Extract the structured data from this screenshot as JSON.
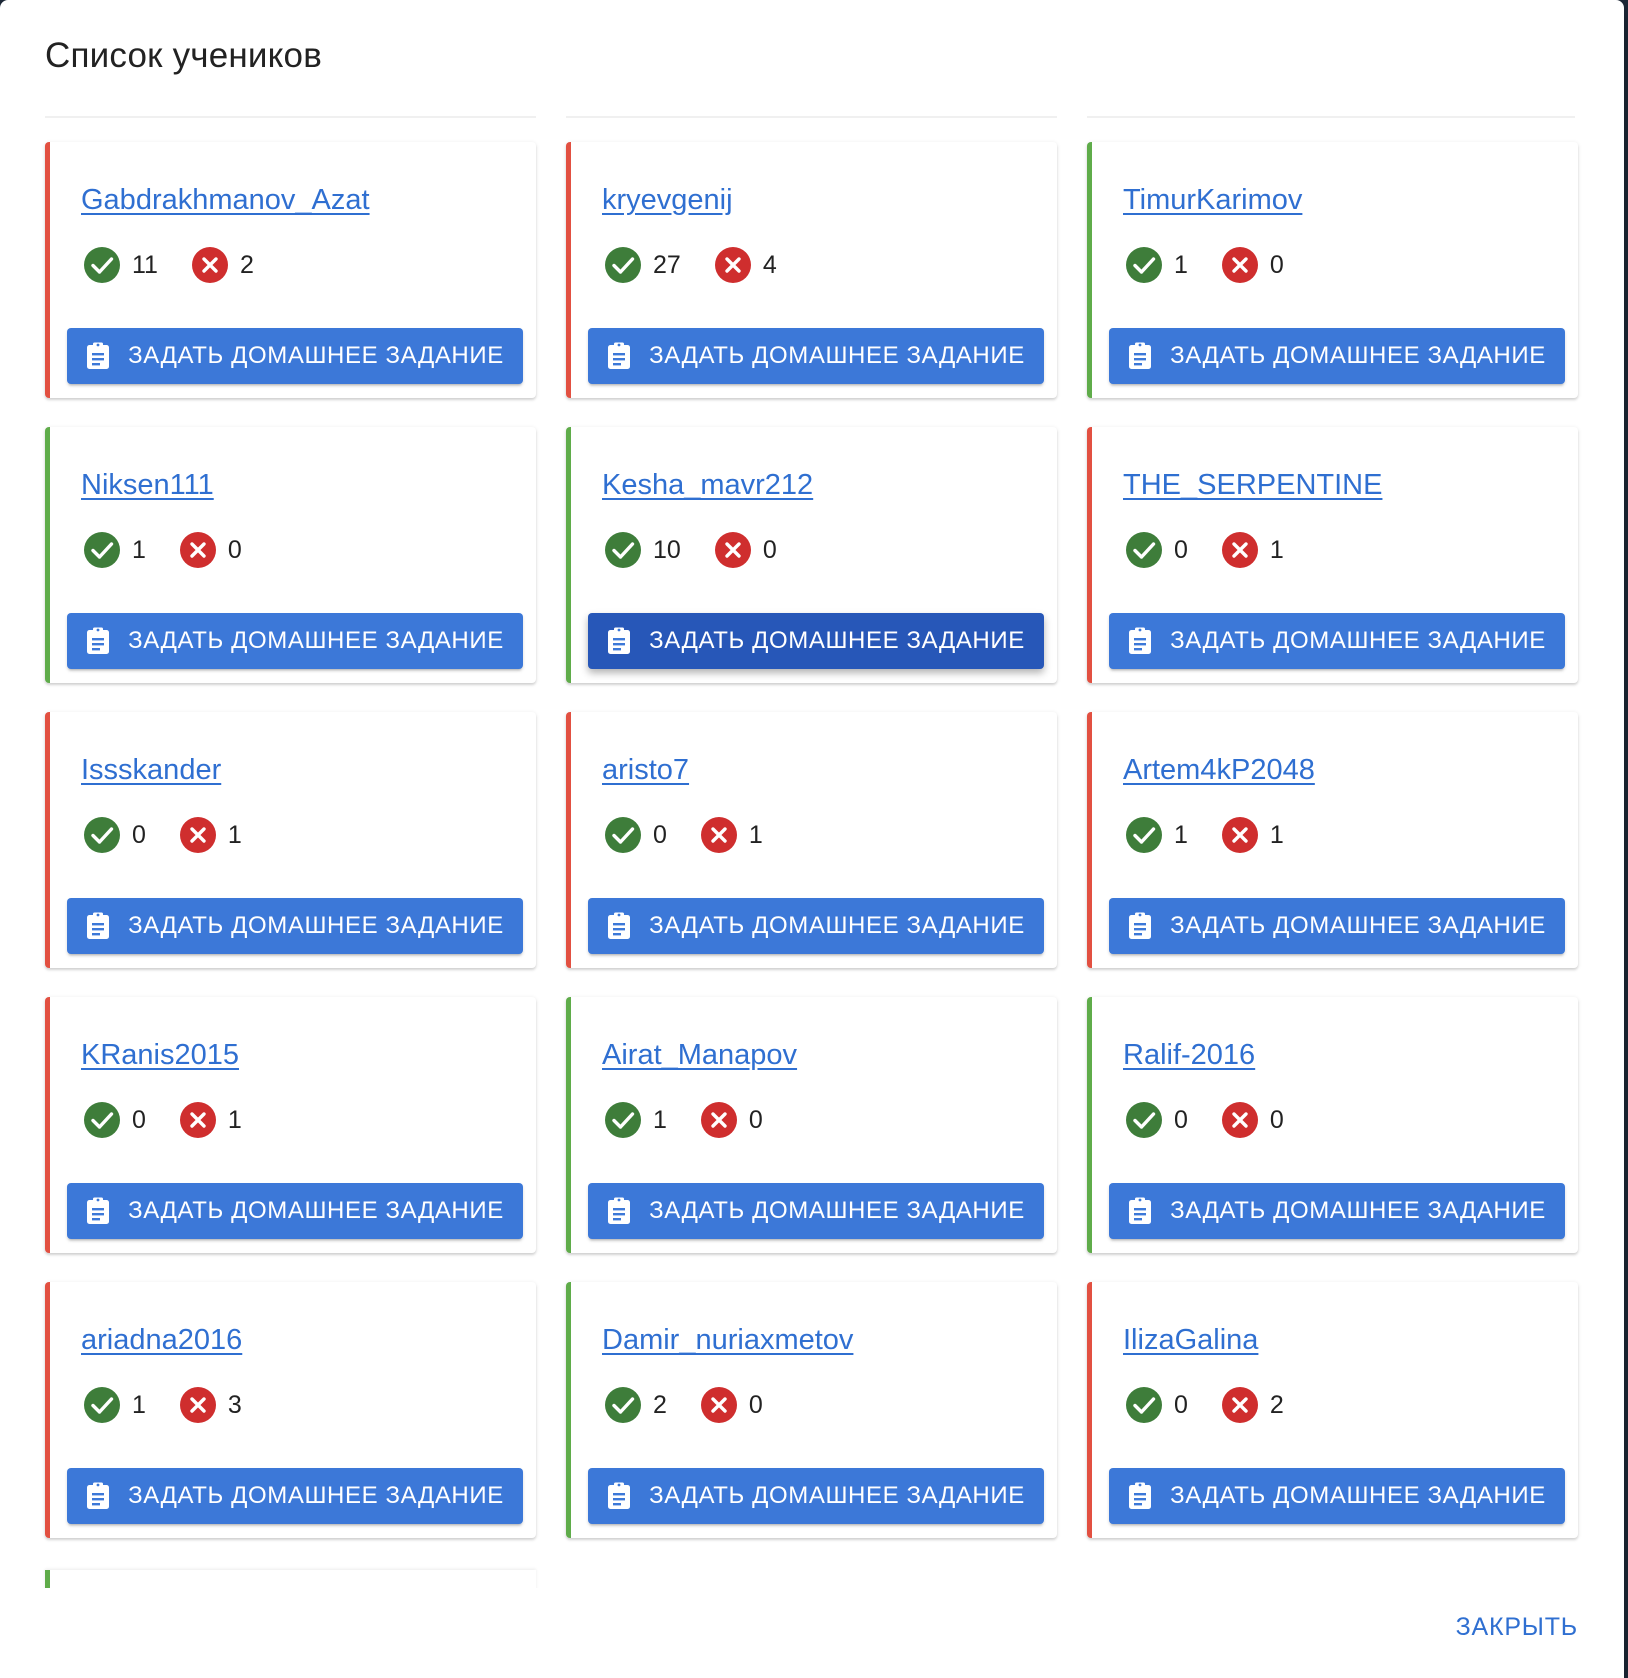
{
  "dialog": {
    "title": "Список учеников",
    "close_label": "ЗАКРЫТЬ"
  },
  "colors": {
    "accent": "#3c78d8",
    "accent_hover": "#2757b8",
    "link": "#2f6fd1",
    "success": "#3e7d3a",
    "error": "#cf2e2e",
    "border_ok": "#5fac4a",
    "border_bad": "#e25041"
  },
  "icons": {
    "success": "check-circle-icon",
    "error": "x-circle-icon",
    "assign": "clipboard-icon"
  },
  "assign_label": "ЗАДАТЬ ДОМАШНЕЕ ЗАДАНИЕ",
  "students": [
    {
      "name": "Gabdrakhmanov_Azat",
      "done": "11",
      "failed": "2",
      "status": "bad"
    },
    {
      "name": "kryevgenij",
      "done": "27",
      "failed": "4",
      "status": "bad"
    },
    {
      "name": "TimurKarimov",
      "done": "1",
      "failed": "0",
      "status": "ok"
    },
    {
      "name": "Niksen111",
      "done": "1",
      "failed": "0",
      "status": "ok"
    },
    {
      "name": "Kesha_mavr212",
      "done": "10",
      "failed": "0",
      "status": "ok",
      "hover": true
    },
    {
      "name": "THE_SERPENTINE",
      "done": "0",
      "failed": "1",
      "status": "bad"
    },
    {
      "name": "Issskander",
      "done": "0",
      "failed": "1",
      "status": "bad"
    },
    {
      "name": " aristo7",
      "done": "0",
      "failed": "1",
      "status": "bad"
    },
    {
      "name": "Artem4kP2048",
      "done": "1",
      "failed": "1",
      "status": "bad"
    },
    {
      "name": "KRanis2015",
      "done": "0",
      "failed": "1",
      "status": "bad"
    },
    {
      "name": "Airat_Manapov",
      "done": "1",
      "failed": "0",
      "status": "ok"
    },
    {
      "name": "Ralif-2016",
      "done": "0",
      "failed": "0",
      "status": "ok"
    },
    {
      "name": "ariadna2016",
      "done": "1",
      "failed": "3",
      "status": "bad"
    },
    {
      "name": "Damir_nuriaxmetov",
      "done": "2",
      "failed": "0",
      "status": "ok"
    },
    {
      "name": "IlizaGalina",
      "done": "0",
      "failed": "2",
      "status": "bad"
    }
  ]
}
